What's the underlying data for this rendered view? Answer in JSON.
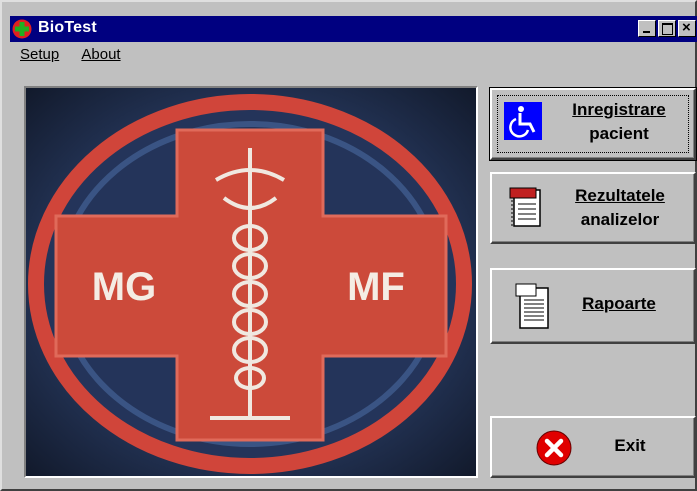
{
  "window": {
    "title": "BioTest",
    "icon": "red-cross-app-icon"
  },
  "menu": {
    "setup": "Setup",
    "about": "About"
  },
  "picture": {
    "left_text": "MG",
    "right_text": "MF"
  },
  "buttons": {
    "register": {
      "line1": "Inregistrare",
      "line2": "pacient",
      "icon": "wheelchair-icon"
    },
    "results": {
      "line1": "Rezultatele",
      "line2": "analizelor",
      "icon": "notebook-icon"
    },
    "reports": {
      "label": "Rapoarte",
      "icon": "report-document-icon"
    },
    "exit": {
      "label": "Exit",
      "icon": "red-x-icon"
    }
  },
  "colors": {
    "titlebar": "#000080",
    "accent_red": "#d94030",
    "face": "#c0c0c0"
  }
}
